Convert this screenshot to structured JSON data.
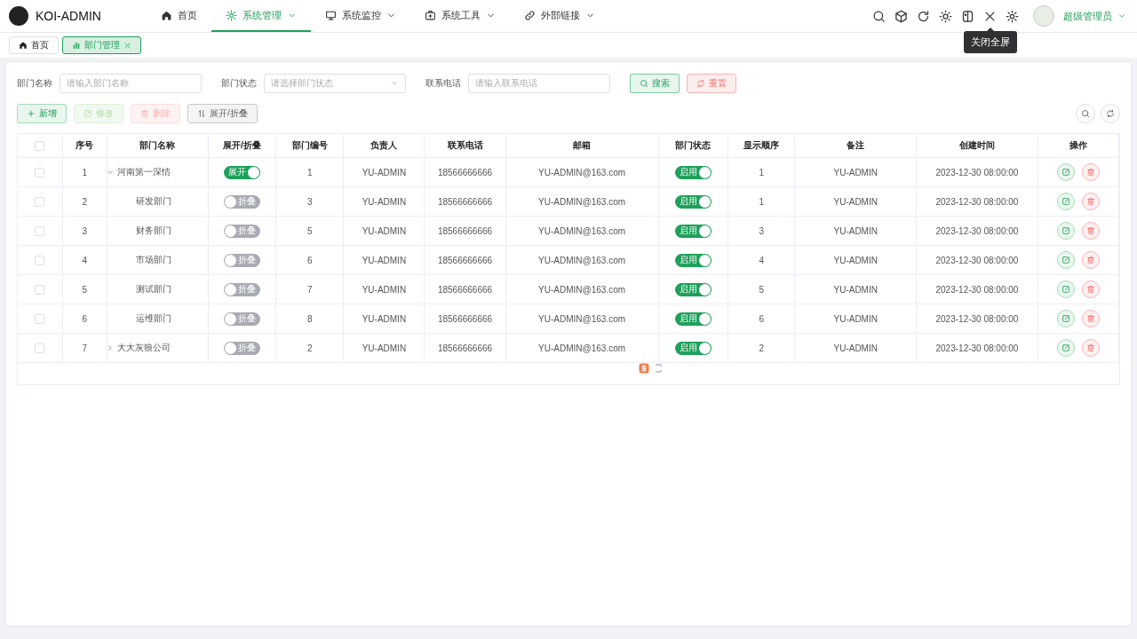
{
  "header": {
    "logo": "KOI-ADMIN",
    "menu": [
      {
        "label": "首页",
        "selected": false,
        "has_dropdown": false
      },
      {
        "label": "系统管理",
        "selected": true,
        "has_dropdown": true
      },
      {
        "label": "系统监控",
        "selected": false,
        "has_dropdown": true
      },
      {
        "label": "系统工具",
        "selected": false,
        "has_dropdown": true
      },
      {
        "label": "外部链接",
        "selected": false,
        "has_dropdown": true
      }
    ],
    "tooltip": "关闭全屏",
    "user": "超级管理员"
  },
  "tabs": [
    {
      "label": "首页",
      "selected": false,
      "closable": false
    },
    {
      "label": "部门管理",
      "selected": true,
      "closable": true
    }
  ],
  "filters": [
    {
      "label": "部门名称",
      "kind": "input",
      "placeholder": "请输入部门名称"
    },
    {
      "label": "部门状态",
      "kind": "select",
      "placeholder": "请选择部门状态"
    },
    {
      "label": "联系电话",
      "kind": "input",
      "placeholder": "请输入联系电话"
    }
  ],
  "form_buttons": [
    {
      "label": "搜索",
      "kind": "search"
    },
    {
      "label": "重置",
      "kind": "reset"
    }
  ],
  "toolbar": [
    {
      "label": "新增",
      "kind": "add",
      "disabled": false
    },
    {
      "label": "修改",
      "kind": "edit",
      "disabled": true
    },
    {
      "label": "删除",
      "kind": "delete",
      "disabled": true
    },
    {
      "label": "展开/折叠",
      "kind": "toggle",
      "disabled": false
    }
  ],
  "table": {
    "select_all_checked": false,
    "columns": [
      "序号",
      "部门名称",
      "展开/折叠",
      "部门编号",
      "负责人",
      "联系电话",
      "邮箱",
      "部门状态",
      "显示顺序",
      "备注",
      "创建时间",
      "操作"
    ],
    "rows": [
      {
        "checked": false,
        "index": "1",
        "name": "河南第一深情",
        "expanded": true,
        "expand_switch": {
          "label": "展开",
          "on": true
        },
        "code": "1",
        "leader": "YU-ADMIN",
        "phone": "18566666666",
        "email": "YU-ADMIN@163.com",
        "status": {
          "label": "启用",
          "on": true
        },
        "order": "1",
        "remark": "YU-ADMIN",
        "created": "2023-12-30 08:00:00",
        "children": [
          {
            "checked": false,
            "index": "2",
            "name": "研发部门",
            "expand_switch": {
              "label": "折叠",
              "on": false
            },
            "code": "3",
            "leader": "YU-ADMIN",
            "phone": "18566666666",
            "email": "YU-ADMIN@163.com",
            "status": {
              "label": "启用",
              "on": true
            },
            "order": "1",
            "remark": "YU-ADMIN",
            "created": "2023-12-30 08:00:00"
          },
          {
            "checked": false,
            "index": "3",
            "name": "财务部门",
            "expand_switch": {
              "label": "折叠",
              "on": false
            },
            "code": "5",
            "leader": "YU-ADMIN",
            "phone": "18566666666",
            "email": "YU-ADMIN@163.com",
            "status": {
              "label": "启用",
              "on": true
            },
            "order": "3",
            "remark": "YU-ADMIN",
            "created": "2023-12-30 08:00:00"
          },
          {
            "checked": false,
            "index": "4",
            "name": "市场部门",
            "expand_switch": {
              "label": "折叠",
              "on": false
            },
            "code": "6",
            "leader": "YU-ADMIN",
            "phone": "18566666666",
            "email": "YU-ADMIN@163.com",
            "status": {
              "label": "启用",
              "on": true
            },
            "order": "4",
            "remark": "YU-ADMIN",
            "created": "2023-12-30 08:00:00"
          },
          {
            "checked": false,
            "index": "5",
            "name": "测试部门",
            "expand_switch": {
              "label": "折叠",
              "on": false
            },
            "code": "7",
            "leader": "YU-ADMIN",
            "phone": "18566666666",
            "email": "YU-ADMIN@163.com",
            "status": {
              "label": "启用",
              "on": true
            },
            "order": "5",
            "remark": "YU-ADMIN",
            "created": "2023-12-30 08:00:00"
          },
          {
            "checked": false,
            "index": "6",
            "name": "运维部门",
            "expand_switch": {
              "label": "折叠",
              "on": false
            },
            "code": "8",
            "leader": "YU-ADMIN",
            "phone": "18566666666",
            "email": "YU-ADMIN@163.com",
            "status": {
              "label": "启用",
              "on": true
            },
            "order": "6",
            "remark": "YU-ADMIN",
            "created": "2023-12-30 08:00:00"
          }
        ]
      },
      {
        "checked": false,
        "index": "7",
        "name": "大大灰狼公司",
        "expanded": false,
        "expand_switch": {
          "label": "折叠",
          "on": false
        },
        "code": "2",
        "leader": "YU-ADMIN",
        "phone": "18566666666",
        "email": "YU-ADMIN@163.com",
        "status": {
          "label": "启用",
          "on": true
        },
        "order": "2",
        "remark": "YU-ADMIN",
        "created": "2023-12-30 08:00:00"
      }
    ]
  }
}
